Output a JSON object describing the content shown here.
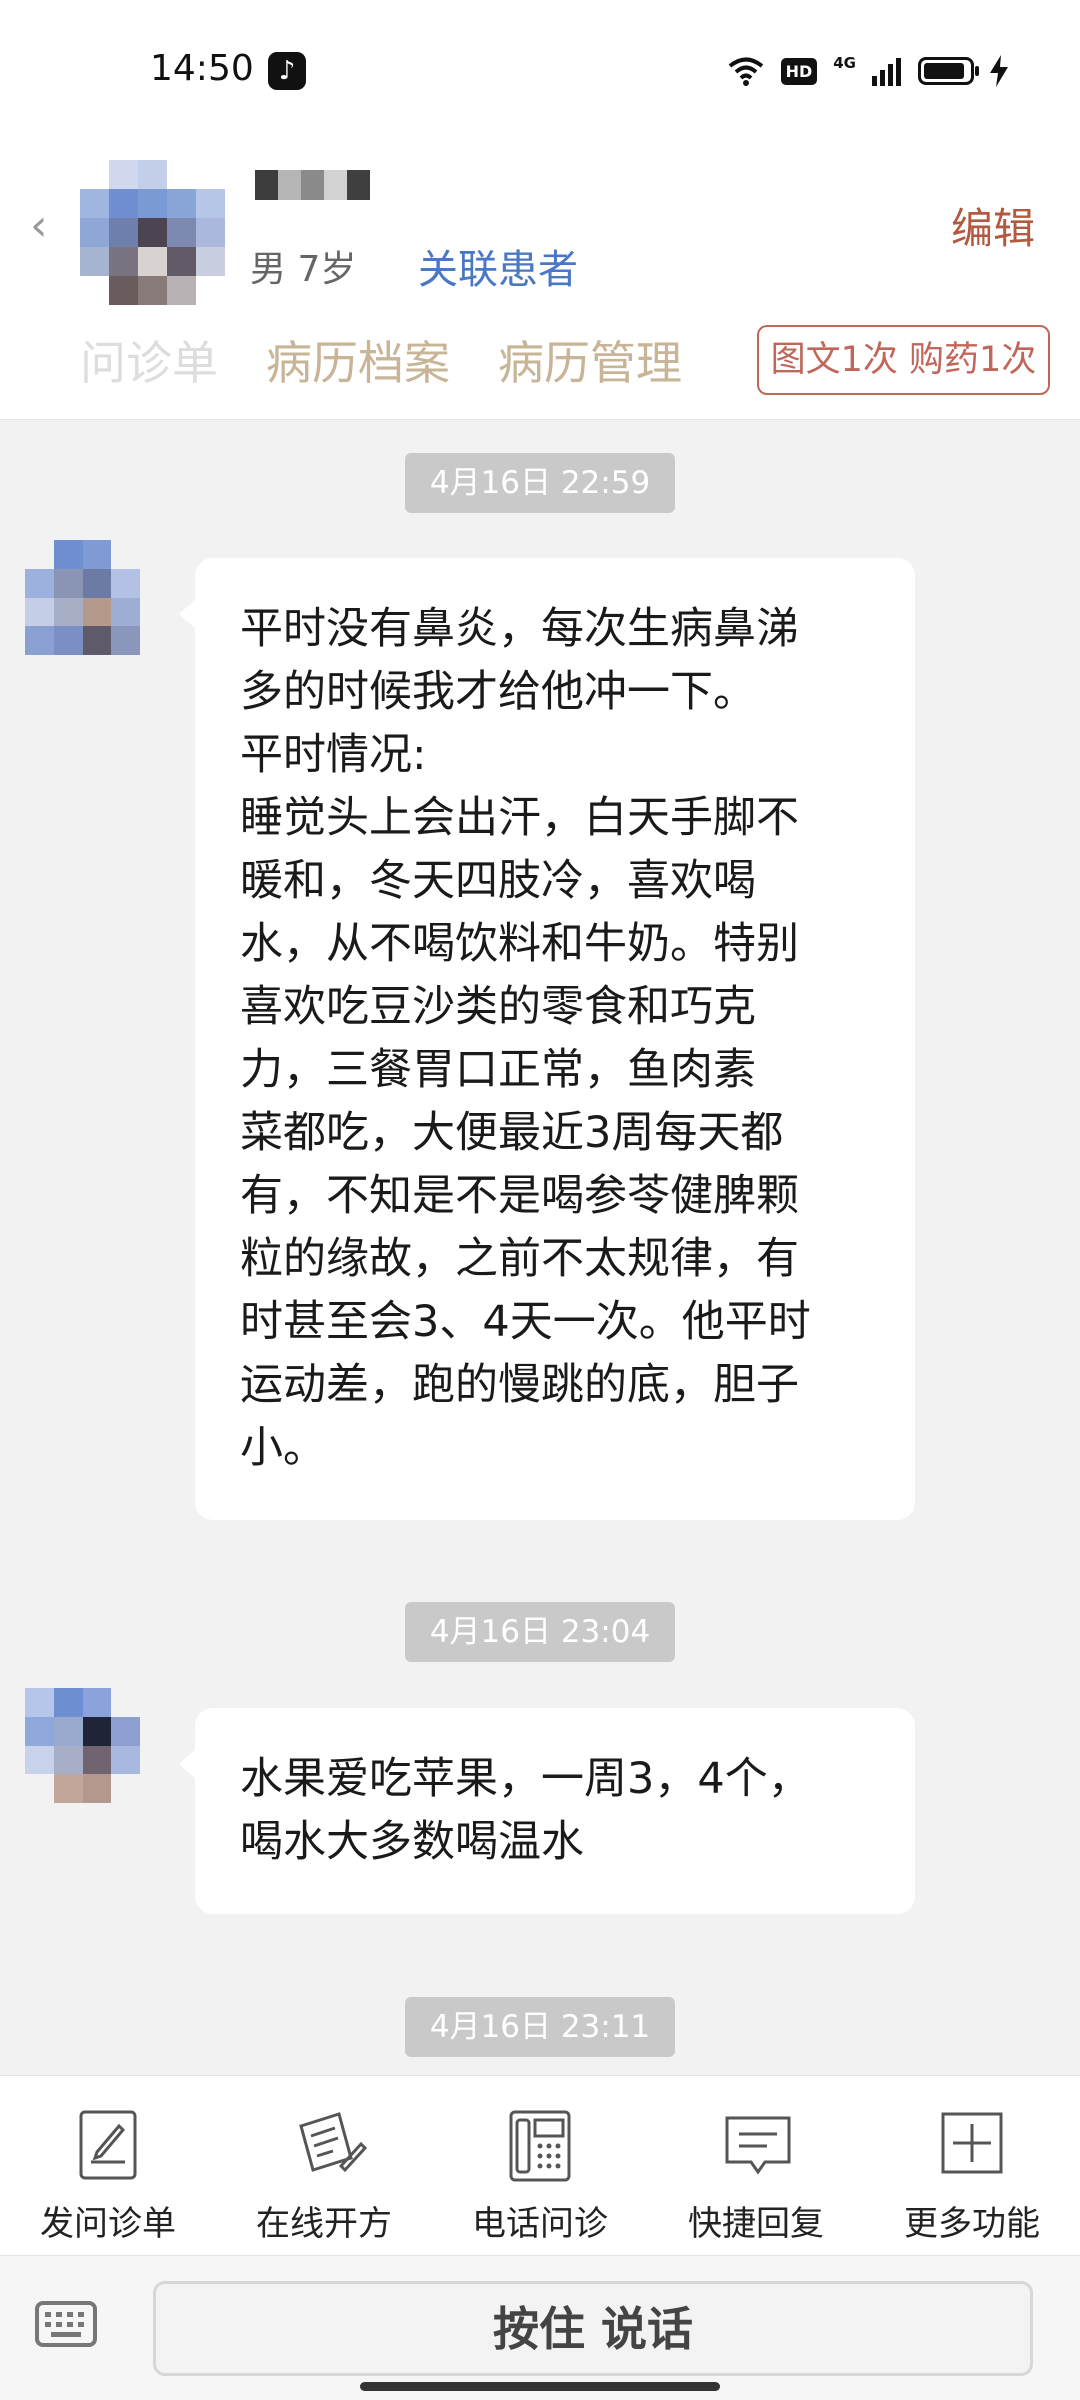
{
  "status_bar": {
    "time": "14:50",
    "hd": "HD",
    "network": "4G"
  },
  "header": {
    "gender_age": "男 7岁",
    "link_patient": "关联患者",
    "edit": "编辑",
    "tabs": [
      "问诊单",
      "病历档案",
      "病历管理"
    ],
    "badge": "图文1次 购药1次"
  },
  "chat": [
    {
      "timestamp": "4月16日 22:59",
      "text": "平时没有鼻炎，每次生病鼻涕\n多的时候我才给他冲一下。\n平时情况:\n睡觉头上会出汗，白天手脚不\n暖和，冬天四肢冷，喜欢喝\n水，从不喝饮料和牛奶。特别\n喜欢吃豆沙类的零食和巧克\n力，三餐胃口正常，鱼肉素\n菜都吃，大便最近3周每天都\n有，不知是不是喝参苓健脾颗\n粒的缘故，之前不太规律，有\n时甚至会3、4天一次。他平时\n运动差，跑的慢跳的底，胆子\n小。"
    },
    {
      "timestamp": "4月16日 23:04",
      "text": "水果爱吃苹果，一周3，4个，\n喝水大多数喝温水"
    },
    {
      "timestamp": "4月16日 23:11"
    }
  ],
  "toolbar": [
    {
      "label": "发问诊单",
      "icon": "form-edit-icon"
    },
    {
      "label": "在线开方",
      "icon": "prescription-icon"
    },
    {
      "label": "电话问诊",
      "icon": "phone-icon"
    },
    {
      "label": "快捷回复",
      "icon": "quick-reply-icon"
    },
    {
      "label": "更多功能",
      "icon": "plus-icon"
    }
  ],
  "input": {
    "hold_to_talk": "按住 说话"
  }
}
